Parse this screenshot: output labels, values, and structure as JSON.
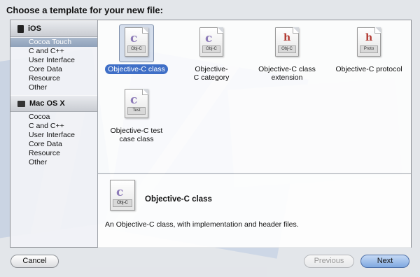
{
  "dialog": {
    "title": "Choose a template for your new file:"
  },
  "sidebar": {
    "groups": [
      {
        "name": "iOS",
        "icon": "device-icon",
        "items": [
          "Cocoa Touch",
          "C and C++",
          "User Interface",
          "Core Data",
          "Resource",
          "Other"
        ],
        "selected_index": 0
      },
      {
        "name": "Mac OS X",
        "icon": "mac-icon",
        "items": [
          "Cocoa",
          "C and C++",
          "User Interface",
          "Core Data",
          "Resource",
          "Other"
        ]
      }
    ]
  },
  "templates": [
    {
      "label": "Objective-C class",
      "glyph": "c",
      "tag": "Obj-C",
      "icon": "objc-class-file-icon",
      "selected": true
    },
    {
      "label": "Objective-C category",
      "glyph": "c",
      "tag": "Obj-C",
      "icon": "objc-category-file-icon"
    },
    {
      "label": "Objective-C class extension",
      "glyph": "h",
      "tag": "Obj-C",
      "icon": "objc-extension-file-icon"
    },
    {
      "label": "Objective-C protocol",
      "glyph": "h",
      "tag": "Proto",
      "icon": "objc-protocol-file-icon"
    },
    {
      "label": "Objective-C test case class",
      "glyph": "c",
      "tag": "Test",
      "icon": "objc-test-file-icon"
    }
  ],
  "detail": {
    "name": "Objective-C class",
    "glyph": "c",
    "tag": "Obj-C",
    "description": "An Objective-C class, with implementation and header files."
  },
  "buttons": {
    "cancel": "Cancel",
    "previous": "Previous",
    "next": "Next"
  }
}
